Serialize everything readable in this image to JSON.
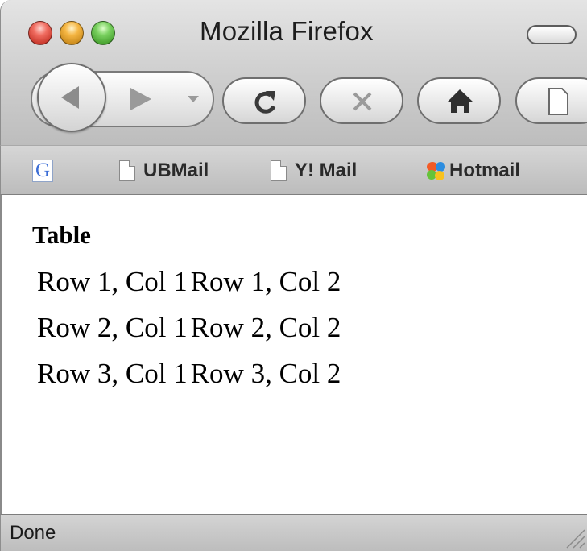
{
  "window": {
    "title": "Mozilla Firefox"
  },
  "toolbar": {
    "back_icon": "back-arrow-icon",
    "forward_icon": "forward-arrow-icon",
    "history_dropdown_icon": "chevron-down-icon",
    "reload_icon": "reload-icon",
    "stop_icon": "close-icon",
    "home_icon": "home-icon",
    "page_icon": "document-icon"
  },
  "bookmarks": {
    "google_glyph": "G",
    "items": [
      {
        "label": "UBMail",
        "icon": "document-icon"
      },
      {
        "label": "Y! Mail",
        "icon": "document-icon"
      },
      {
        "label": "Hotmail",
        "icon": "msn-butterfly-icon"
      }
    ]
  },
  "page": {
    "heading": "Table",
    "table": {
      "rows": [
        [
          "Row 1, Col 1",
          "Row 1, Col 2"
        ],
        [
          "Row 2, Col 1",
          "Row 2, Col 2"
        ],
        [
          "Row 3, Col 1",
          "Row 3, Col 2"
        ]
      ]
    }
  },
  "status": {
    "text": "Done"
  }
}
